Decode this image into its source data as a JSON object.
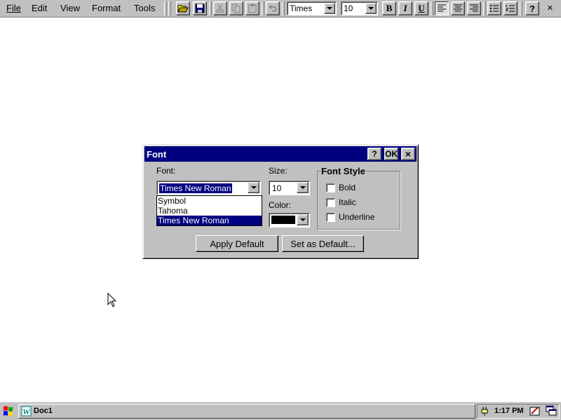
{
  "menu": {
    "file": "File",
    "edit": "Edit",
    "view": "View",
    "format": "Format",
    "tools": "Tools"
  },
  "toolbar": {
    "font_value": "Times",
    "size_value": "10",
    "bold": "B",
    "italic": "I",
    "underline": "U",
    "help": "?",
    "close": "×"
  },
  "dialog": {
    "title": "Font",
    "help_button": "?",
    "ok_button": "OK",
    "close_button": "×",
    "font_label": "Font:",
    "font_value": "Times New Roman",
    "font_options": [
      "Symbol",
      "Tahoma",
      "Times New Roman"
    ],
    "size_label": "Size:",
    "size_value": "10",
    "color_label": "Color:",
    "color_value": "#000000",
    "font_style_title": "Font Style",
    "styles": {
      "bold": "Bold",
      "italic": "Italic",
      "underline": "Underline"
    },
    "apply_default": "Apply Default",
    "set_as_default": "Set as Default..."
  },
  "taskbar": {
    "task_label": "Doc1",
    "clock": "1:17 PM"
  },
  "colors": {
    "face": "#c0c0c0",
    "titlebar": "#000080",
    "selection": "#000080",
    "desktop": "#ffffff"
  }
}
